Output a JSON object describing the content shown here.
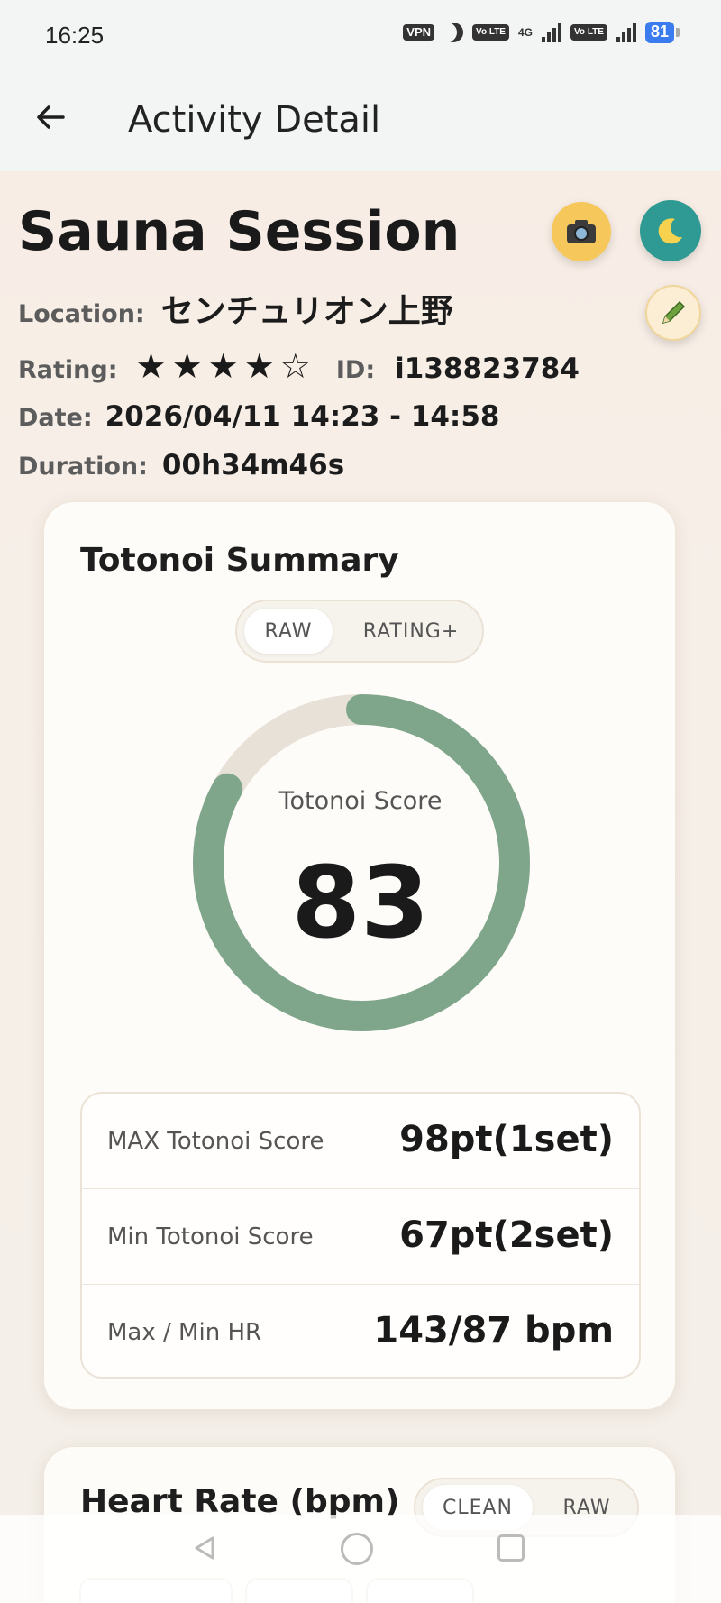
{
  "status_bar": {
    "time": "16:25",
    "vpn": "VPN",
    "volte1": "Vo LTE",
    "network": "4G",
    "volte2": "Vo LTE",
    "battery": "81"
  },
  "app_bar": {
    "title": "Activity Detail"
  },
  "activity": {
    "title": "Sauna Session",
    "location_label": "Location:",
    "location": "センチュリオン上野",
    "rating_label": "Rating:",
    "rating_stars": "★★★★☆",
    "rating_value": 4,
    "rating_max": 5,
    "id_label": "ID:",
    "id": "i138823784",
    "date_label": "Date:",
    "date": "2026/04/11 14:23 - 14:58",
    "duration_label": "Duration:",
    "duration": "00h34m46s"
  },
  "actions": {
    "camera_icon": "camera-icon",
    "moon_icon": "moon-icon",
    "edit_icon": "pencil-icon"
  },
  "summary": {
    "title": "Totonoi Summary",
    "toggle": [
      "RAW",
      "RATING+"
    ],
    "active_toggle": "RAW",
    "score_label": "Totonoi Score",
    "score": "83",
    "score_fraction": 0.83,
    "stats": [
      {
        "label": "MAX Totonoi Score",
        "value": "98pt(1set)"
      },
      {
        "label": "Min Totonoi Score",
        "value": "67pt(2set)"
      },
      {
        "label": "Max / Min HR",
        "value": "143/87 bpm"
      }
    ]
  },
  "heart_rate": {
    "title": "Heart Rate (bpm)",
    "toggle": [
      "CLEAN",
      "RAW"
    ],
    "active_toggle": "CLEAN"
  },
  "colors": {
    "gauge_fill": "#7fa68b",
    "gauge_track": "#e8e1d8",
    "camera_btn": "#f6c85c",
    "moon_btn": "#2f9a93"
  }
}
